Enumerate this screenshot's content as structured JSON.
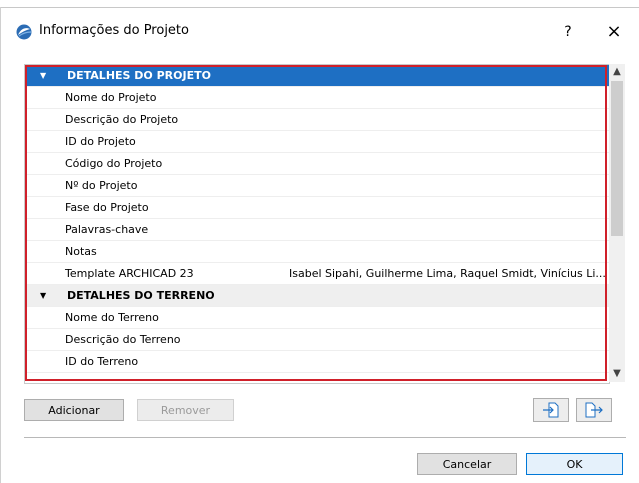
{
  "window": {
    "title": "Informações do Projeto",
    "help": "?",
    "close": "×",
    "app_icon": "archicad-logo-icon"
  },
  "grid": {
    "rows": [
      {
        "kind": "section",
        "selected": true,
        "label": "DETALHES DO PROJETO",
        "value": ""
      },
      {
        "kind": "item",
        "label": "Nome do Projeto",
        "value": ""
      },
      {
        "kind": "item",
        "label": "Descrição do Projeto",
        "value": ""
      },
      {
        "kind": "item",
        "label": "ID do Projeto",
        "value": ""
      },
      {
        "kind": "item",
        "label": "Código do Projeto",
        "value": ""
      },
      {
        "kind": "item",
        "label": "Nº do Projeto",
        "value": ""
      },
      {
        "kind": "item",
        "label": "Fase do Projeto",
        "value": ""
      },
      {
        "kind": "item",
        "label": "Palavras-chave",
        "value": ""
      },
      {
        "kind": "item",
        "label": "Notas",
        "value": ""
      },
      {
        "kind": "item",
        "label": "Template ARCHICAD 23",
        "value": "Isabel Sipahi, Guilherme Lima, Raquel Smidt, Vinícius Li..."
      },
      {
        "kind": "section",
        "selected": false,
        "label": "DETALHES DO TERRENO",
        "value": ""
      },
      {
        "kind": "item",
        "label": "Nome do Terreno",
        "value": ""
      },
      {
        "kind": "item",
        "label": "Descrição do Terreno",
        "value": ""
      },
      {
        "kind": "item",
        "label": "ID do Terreno",
        "value": ""
      }
    ]
  },
  "buttons": {
    "add": "Adicionar",
    "remove": "Remover",
    "import_icon": "import-file-icon",
    "export_icon": "export-file-icon",
    "cancel": "Cancelar",
    "ok": "OK"
  },
  "colors": {
    "selection": "#1e6fc3",
    "highlight_border": "#d0202a",
    "section_bg": "#efefef"
  }
}
